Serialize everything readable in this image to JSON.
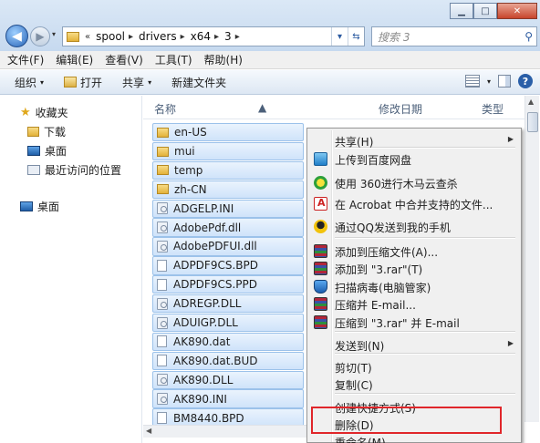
{
  "window": {
    "minimize_glyph": "▁",
    "maximize_glyph": "□",
    "close_glyph": "✕"
  },
  "nav": {
    "back_glyph": "◀",
    "forward_glyph": "▶",
    "history_glyph": "▾"
  },
  "address": {
    "prefix": "«",
    "crumbs": [
      "spool",
      "drivers",
      "x64",
      "3"
    ],
    "separator": "▸",
    "dropdown_glyph": "▾",
    "refresh_glyph": "⇆"
  },
  "search": {
    "placeholder": "搜索 3",
    "icon": "search-icon"
  },
  "menu": [
    "文件(F)",
    "编辑(E)",
    "查看(V)",
    "工具(T)",
    "帮助(H)"
  ],
  "toolbar": {
    "organize": "组织",
    "open": "打开",
    "share": "共享",
    "new_folder": "新建文件夹",
    "dropdown_glyph": "▾",
    "help_glyph": "?"
  },
  "navpane": {
    "favorites": "收藏夹",
    "downloads": "下载",
    "desktop": "桌面",
    "recent": "最近访问的位置",
    "desktop_root": "桌面"
  },
  "columns": {
    "name": "名称",
    "date": "修改日期",
    "type": "类型",
    "sort_glyph": "▲"
  },
  "files": [
    {
      "name": "en-US",
      "kind": "folder"
    },
    {
      "name": "mui",
      "kind": "folder"
    },
    {
      "name": "temp",
      "kind": "folder"
    },
    {
      "name": "zh-CN",
      "kind": "folder"
    },
    {
      "name": "ADGELP.INI",
      "kind": "gear"
    },
    {
      "name": "AdobePdf.dll",
      "kind": "gear"
    },
    {
      "name": "AdobePDFUI.dll",
      "kind": "gear"
    },
    {
      "name": "ADPDF9CS.BPD",
      "kind": "text"
    },
    {
      "name": "ADPDF9CS.PPD",
      "kind": "text"
    },
    {
      "name": "ADREGP.DLL",
      "kind": "gear"
    },
    {
      "name": "ADUIGP.DLL",
      "kind": "gear"
    },
    {
      "name": "AK890.dat",
      "kind": "text"
    },
    {
      "name": "AK890.dat.BUD",
      "kind": "text"
    },
    {
      "name": "AK890.DLL",
      "kind": "gear"
    },
    {
      "name": "AK890.INI",
      "kind": "gear"
    },
    {
      "name": "BM8440.BPD",
      "kind": "text"
    }
  ],
  "scroll": {
    "up_glyph": "▲",
    "left_glyph": "◀"
  },
  "context_menu": {
    "submenu_glyph": "▶",
    "items": [
      {
        "label": "共享(H)",
        "submenu": true
      },
      {
        "label": "上传到百度网盘",
        "icon": "baidu-cloud-icon"
      },
      {
        "label": "使用 360进行木马云查杀",
        "icon": "360-icon"
      },
      {
        "label": "在 Acrobat 中合并支持的文件...",
        "icon": "acrobat-icon"
      },
      {
        "label": "通过QQ发送到我的手机",
        "icon": "qq-icon"
      },
      {
        "label": "添加到压缩文件(A)...",
        "icon": "winrar-icon"
      },
      {
        "label": "添加到 \"3.rar\"(T)",
        "icon": "winrar-icon"
      },
      {
        "label": "扫描病毒(电脑管家)",
        "icon": "shield-icon"
      },
      {
        "label": "压缩并 E-mail...",
        "icon": "winrar-icon"
      },
      {
        "label": "压缩到 \"3.rar\" 并 E-mail",
        "icon": "winrar-icon"
      },
      {
        "label": "发送到(N)",
        "submenu": true
      },
      {
        "label": "剪切(T)"
      },
      {
        "label": "复制(C)"
      },
      {
        "label": "创建快捷方式(S)"
      },
      {
        "label": "删除(D)"
      },
      {
        "label": "重命名(M)"
      }
    ]
  },
  "colors": {
    "highlight_box": "#e0262a",
    "selection": "#cfe3fa"
  }
}
